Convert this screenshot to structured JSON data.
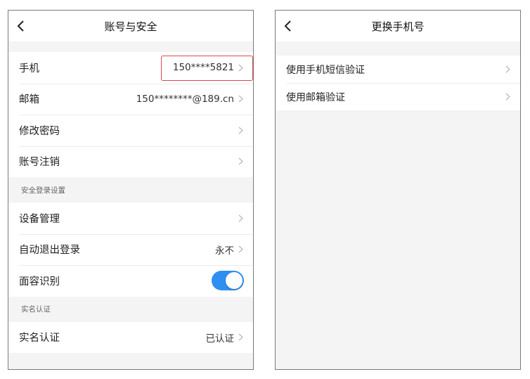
{
  "left": {
    "title": "账号与安全",
    "account_rows": [
      {
        "label": "手机",
        "value": "150****5821"
      },
      {
        "label": "邮箱",
        "value": "150********@189.cn"
      },
      {
        "label": "修改密码",
        "value": ""
      },
      {
        "label": "账号注销",
        "value": ""
      }
    ],
    "security_section": {
      "header": "安全登录设置",
      "rows": [
        {
          "label": "设备管理",
          "value": ""
        },
        {
          "label": "自动退出登录",
          "value": "永不"
        },
        {
          "label": "面容识别",
          "toggle_on": true
        }
      ]
    },
    "realname_section": {
      "header": "实名认证",
      "rows": [
        {
          "label": "实名认证",
          "value": "已认证"
        }
      ]
    }
  },
  "right": {
    "title": "更换手机号",
    "rows": [
      {
        "label": "使用手机短信验证"
      },
      {
        "label": "使用邮箱验证"
      }
    ]
  },
  "colors": {
    "accent": "#2f8ff0",
    "highlight": "#e0474c",
    "background": "#f4f4f4"
  },
  "icons": {
    "back": "chevron-left-icon",
    "row_arrow": "chevron-right-icon"
  }
}
